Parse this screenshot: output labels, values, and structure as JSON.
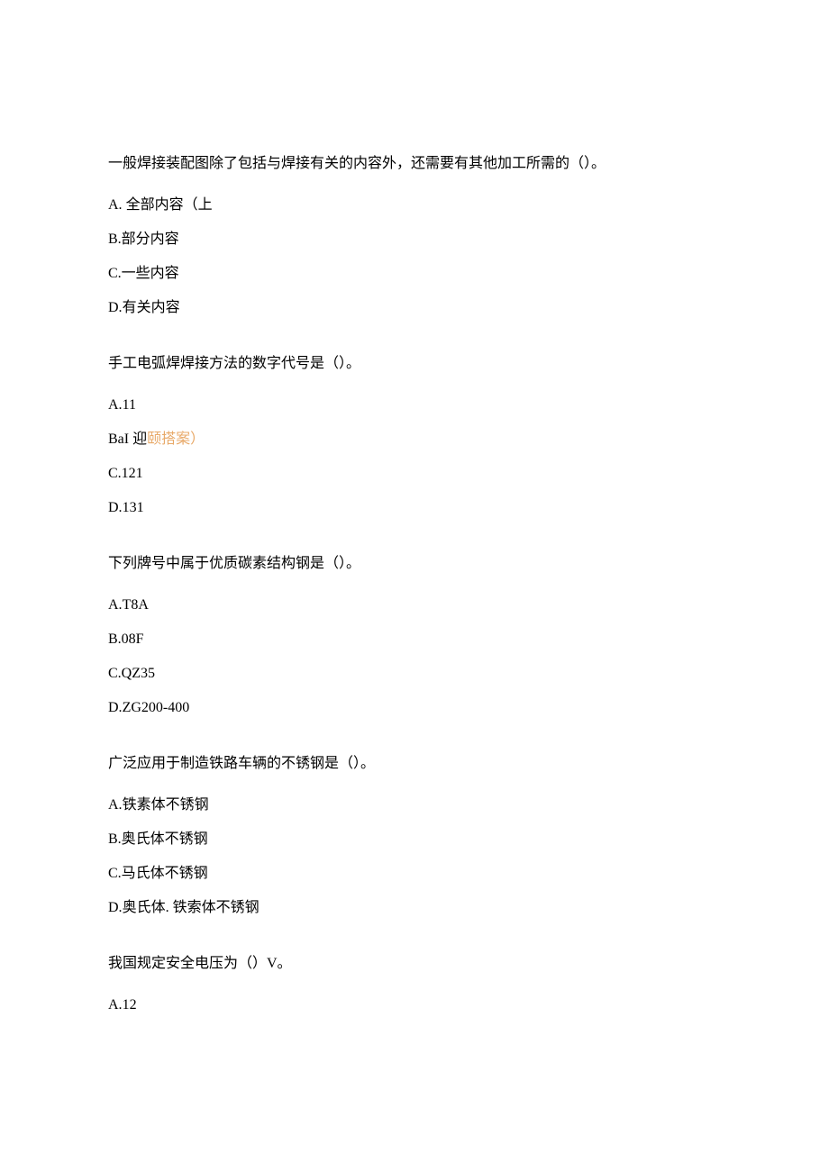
{
  "questions": [
    {
      "text": "一般焊接装配图除了包括与焊接有关的内容外，还需要有其他加工所需的（）。",
      "options": [
        {
          "prefix": "A. ",
          "text": "全部内容（上",
          "highlight": ""
        },
        {
          "prefix": "B.",
          "text": "部分内容",
          "highlight": ""
        },
        {
          "prefix": "C.",
          "text": "一些内容",
          "highlight": ""
        },
        {
          "prefix": "D.",
          "text": "有关内容",
          "highlight": ""
        }
      ]
    },
    {
      "text": "手工电弧焊焊接方法的数字代号是（）。",
      "options": [
        {
          "prefix": "A.",
          "text": "11",
          "highlight": ""
        },
        {
          "prefix": "BaI 迎",
          "text": "",
          "highlight": "颐搭案）"
        },
        {
          "prefix": "C.",
          "text": "121",
          "highlight": ""
        },
        {
          "prefix": "D.",
          "text": "131",
          "highlight": ""
        }
      ]
    },
    {
      "text": "下列牌号中属于优质碳素结构钢是（）。",
      "options": [
        {
          "prefix": "A.",
          "text": "T8A",
          "highlight": ""
        },
        {
          "prefix": "B.",
          "text": "08F",
          "highlight": ""
        },
        {
          "prefix": "C.",
          "text": "QZ35",
          "highlight": ""
        },
        {
          "prefix": "D.",
          "text": "ZG200-400",
          "highlight": ""
        }
      ]
    },
    {
      "text": "广泛应用于制造铁路车辆的不锈钢是（）。",
      "options": [
        {
          "prefix": "A.",
          "text": "铁素体不锈钢",
          "highlight": ""
        },
        {
          "prefix": "B.",
          "text": "奥氏体不锈钢",
          "highlight": ""
        },
        {
          "prefix": "C.",
          "text": "马氏体不锈钢",
          "highlight": ""
        },
        {
          "prefix": "D.",
          "text": "奥氏体. 铁索体不锈钢",
          "highlight": ""
        }
      ]
    },
    {
      "text": "我国规定安全电压为（）V。",
      "options": [
        {
          "prefix": "A.",
          "text": "12",
          "highlight": ""
        }
      ]
    }
  ]
}
